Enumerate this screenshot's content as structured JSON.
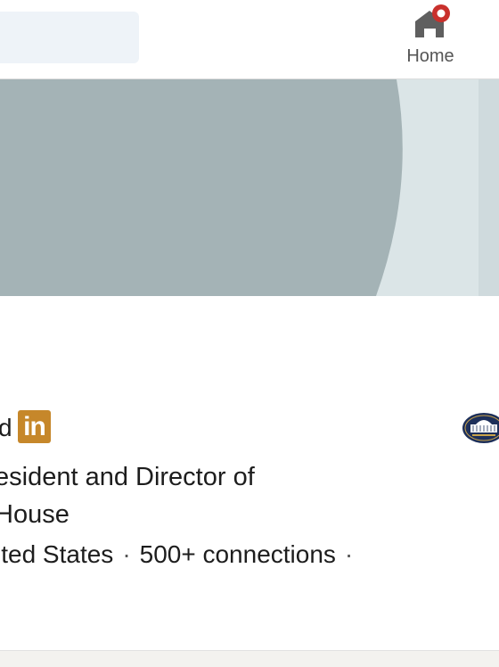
{
  "nav": {
    "home_label": "Home"
  },
  "profile": {
    "name_tail": "d",
    "linkedin_badge": "in",
    "headline": "esident and Director of House",
    "headline_line1": "esident and Director of",
    "headline_line2": "House",
    "location": "ited States",
    "connections": "500+ connections",
    "separator": "·"
  },
  "colors": {
    "banner_dark": "#a4b3b6",
    "banner_light": "#dbe5e7",
    "linkedin_badge": "#c6872a",
    "notification": "#c9302c"
  },
  "icons": {
    "home": "home-icon",
    "notification": "notification-badge-icon",
    "org_logo": "white-house-seal-icon"
  }
}
